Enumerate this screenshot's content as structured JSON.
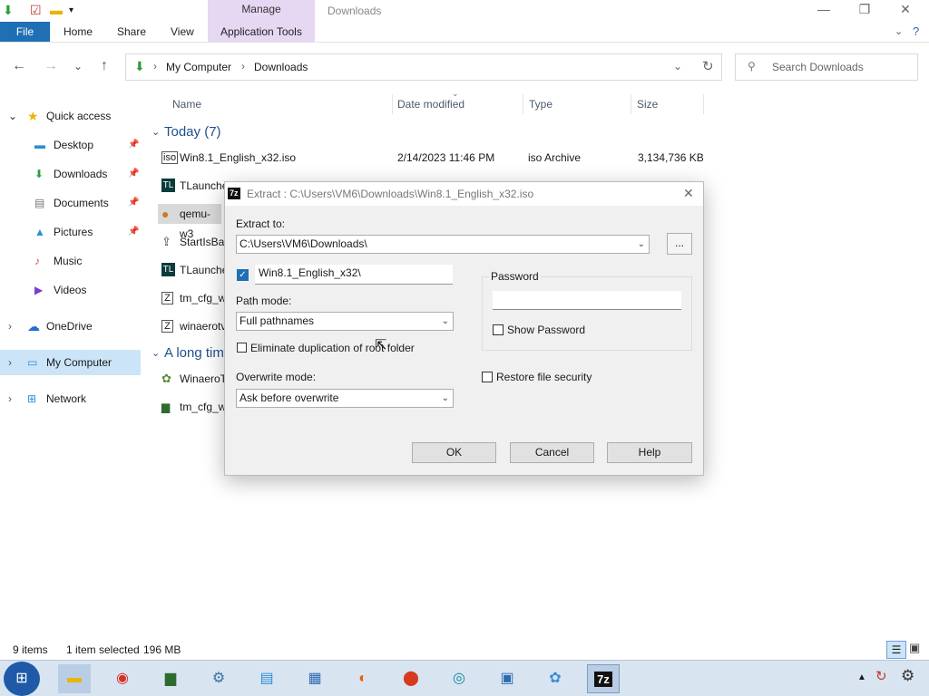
{
  "window": {
    "title": "Downloads",
    "contextual_tab": "Manage",
    "ribbon_tabs": [
      "File",
      "Home",
      "Share",
      "View",
      "Application Tools"
    ],
    "controls": {
      "minimize": "—",
      "maximize": "❐",
      "close": "✕"
    }
  },
  "navbar": {
    "back": "←",
    "forward": "→",
    "recent": "⌄",
    "up": "↑",
    "breadcrumb": [
      "My Computer",
      "Downloads"
    ],
    "search_placeholder": "Search Downloads"
  },
  "sidebar": {
    "items": [
      {
        "label": "Quick access",
        "icon": "star-icon"
      },
      {
        "label": "Desktop",
        "icon": "desktop-icon",
        "pinned": true
      },
      {
        "label": "Downloads",
        "icon": "download-icon",
        "pinned": true
      },
      {
        "label": "Documents",
        "icon": "document-icon",
        "pinned": true
      },
      {
        "label": "Pictures",
        "icon": "picture-icon",
        "pinned": true
      },
      {
        "label": "Music",
        "icon": "music-icon"
      },
      {
        "label": "Videos",
        "icon": "video-icon"
      },
      {
        "label": "OneDrive",
        "icon": "cloud-icon"
      },
      {
        "label": "My Computer",
        "icon": "computer-icon",
        "selected": true
      },
      {
        "label": "Network",
        "icon": "network-icon"
      }
    ]
  },
  "columns": {
    "name": "Name",
    "date": "Date modified",
    "type": "Type",
    "size": "Size"
  },
  "groups": {
    "today": "Today (7)",
    "long_time": "A long tim"
  },
  "files": [
    {
      "name": "Win8.1_English_x32.iso",
      "date": "2/14/2023 11:46 PM",
      "type": "iso Archive",
      "size": "3,134,736 KB"
    },
    {
      "name": "TLaunche"
    },
    {
      "name": "qemu-w3"
    },
    {
      "name": "StartIsBac"
    },
    {
      "name": "TLaunche"
    },
    {
      "name": "tm_cfg_w"
    },
    {
      "name": "winaerotv"
    },
    {
      "name": "WinaeroT"
    },
    {
      "name": "tm_cfg_w"
    }
  ],
  "status": {
    "items": "9 items",
    "selected": "1 item selected",
    "size": "196 MB"
  },
  "dialog": {
    "icon": "7z",
    "title": "Extract : C:\\Users\\VM6\\Downloads\\Win8.1_English_x32.iso",
    "extract_to_label": "Extract to:",
    "extract_to_value": "C:\\Users\\VM6\\Downloads\\",
    "browse": "...",
    "folder_name": "Win8.1_English_x32\\",
    "path_mode_label": "Path mode:",
    "path_mode_value": "Full pathnames",
    "eliminate_label": "Eliminate duplication of root folder",
    "overwrite_label": "Overwrite mode:",
    "overwrite_value": "Ask before overwrite",
    "password_label": "Password",
    "show_password": "Show Password",
    "restore_security": "Restore file security",
    "ok": "OK",
    "cancel": "Cancel",
    "help": "Help"
  },
  "colors": {
    "accent": "#1f6fb5",
    "manage": "#e6d7f3",
    "selected_nav": "#cce4f7"
  }
}
